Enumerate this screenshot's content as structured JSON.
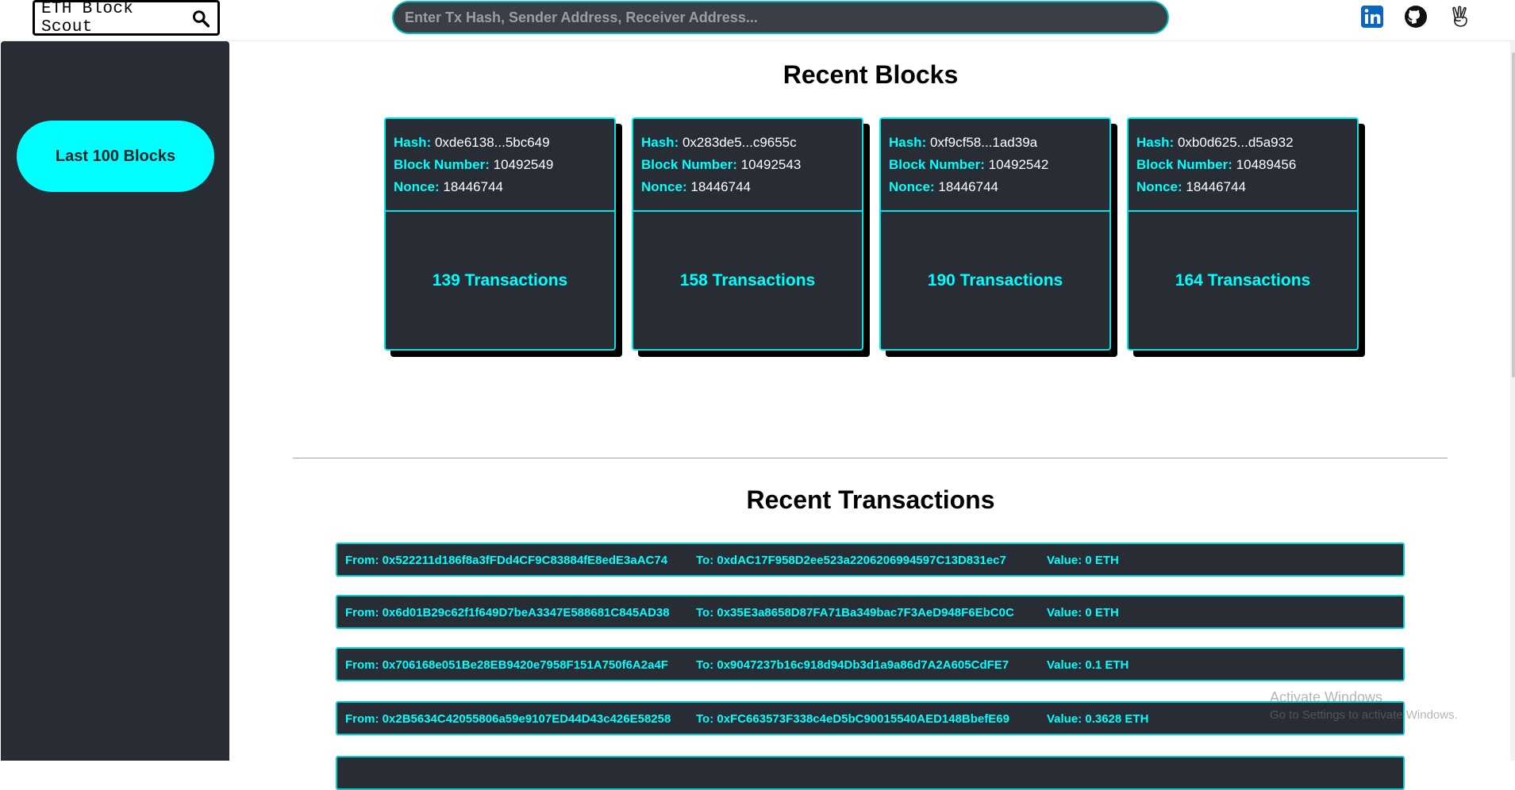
{
  "header": {
    "logo_text": "ETH Block Scout",
    "search_placeholder": "Enter Tx Hash, Sender Address, Receiver Address...",
    "social_icons": [
      "linkedin-icon",
      "github-icon",
      "angellist-icon"
    ]
  },
  "sidebar": {
    "button_label": "Last 100 Blocks"
  },
  "blocks_section": {
    "title": "Recent Blocks",
    "hash_label": "Hash:",
    "block_number_label": "Block Number:",
    "nonce_label": "Nonce:",
    "blocks": [
      {
        "hash": "0xde6138...5bc649",
        "block_number": "10492549",
        "nonce": "18446744",
        "transactions": "139 Transactions"
      },
      {
        "hash": "0x283de5...c9655c",
        "block_number": "10492543",
        "nonce": "18446744",
        "transactions": "158 Transactions"
      },
      {
        "hash": "0xf9cf58...1ad39a",
        "block_number": "10492542",
        "nonce": "18446744",
        "transactions": "190 Transactions"
      },
      {
        "hash": "0xb0d625...d5a932",
        "block_number": "10489456",
        "nonce": "18446744",
        "transactions": "164 Transactions"
      }
    ]
  },
  "transactions_section": {
    "title": "Recent Transactions",
    "rows": [
      {
        "from": "From: 0x522211d186f8a3fFDd4CF9C83884fE8edE3aAC74",
        "to": "To: 0xdAC17F958D2ee523a2206206994597C13D831ec7",
        "value": "Value: 0 ETH"
      },
      {
        "from": "From: 0x6d01B29c62f1f649D7beA3347E588681C845AD38",
        "to": "To: 0x35E3a8658D87FA71Ba349bac7F3AeD948F6EbC0C",
        "value": "Value: 0 ETH"
      },
      {
        "from": "From: 0x706168e051Be28EB9420e7958F151A750f6A2a4F",
        "to": "To: 0x9047237b16c918d94Db3d1a9a86d7A2A605CdFE7",
        "value": "Value: 0.1 ETH"
      },
      {
        "from": "From: 0x2B5634C42055806a59e9107ED44D43c426E58258",
        "to": "To: 0xFC663573F338c4eD5bC90015540AED148BbefE69",
        "value": "Value: 0.3628 ETH"
      }
    ]
  },
  "watermark": {
    "line1": "Activate Windows",
    "line2": "Go to Settings to activate Windows."
  },
  "colors": {
    "accent": "#00ffff",
    "panel": "#282c34",
    "card_border": "#00e5e5"
  }
}
